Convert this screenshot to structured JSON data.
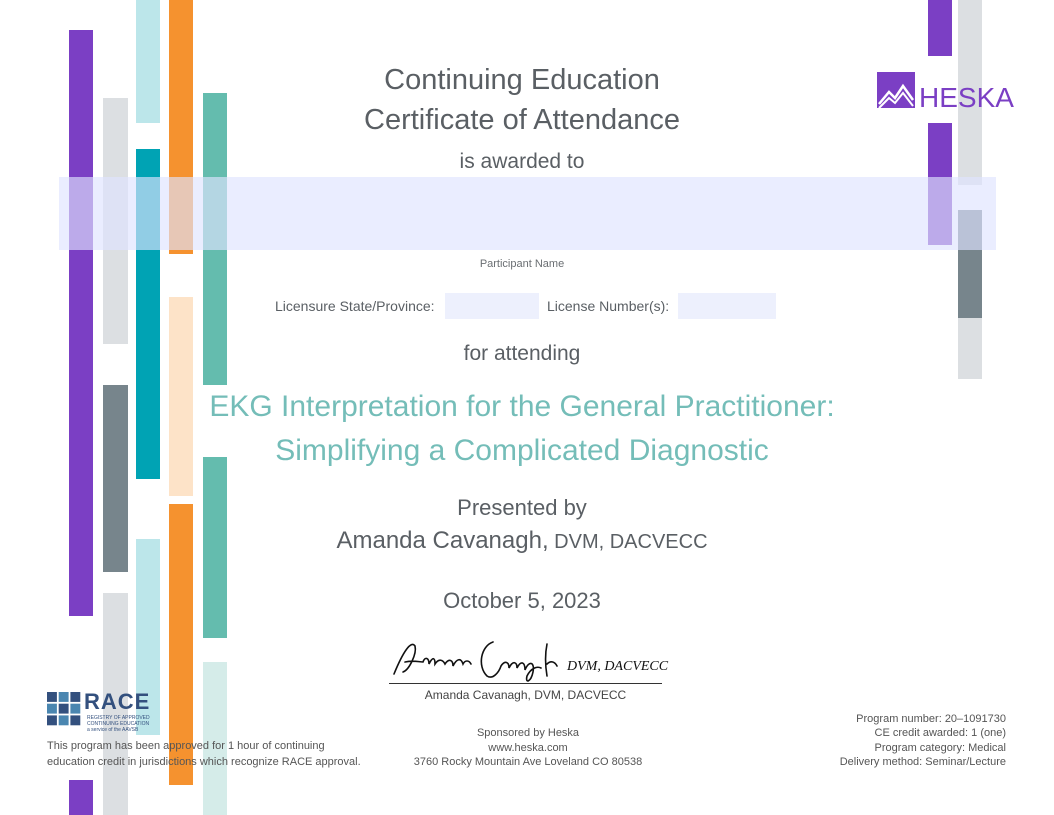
{
  "header": {
    "title_line1": "Continuing Education",
    "title_line2": "Certificate of Attendance",
    "awarded_to": "is awarded to"
  },
  "participant": {
    "name_label": "Participant Name",
    "name_value": ""
  },
  "licensure": {
    "state_label": "Licensure State/Province:",
    "state_value": "",
    "number_label": "License Number(s):",
    "number_value": ""
  },
  "course": {
    "for_attending": "for attending",
    "title_line1": "EKG Interpretation for the General Practitioner:",
    "title_line2": "Simplifying a Complicated Diagnostic"
  },
  "presenter": {
    "presented_by": "Presented by",
    "name": "Amanda Cavanagh,",
    "credentials": " DVM, DACVECC"
  },
  "event": {
    "date": "October 5, 2023"
  },
  "signature": {
    "caption": "Amanda Cavanagh, DVM, DACVECC"
  },
  "race": {
    "logo_text": "RACE",
    "logo_subtext_1": "REGISTRY OF APPROVED",
    "logo_subtext_2": "CONTINUING EDUCATION",
    "logo_subtext_3": "a service of the AAVSB",
    "approval_line1": "This program has been approved for 1 hour of continuing",
    "approval_line2": "education credit in jurisdictions which recognize RACE approval."
  },
  "sponsor": {
    "line1": "Sponsored by Heska",
    "line2": "www.heska.com",
    "line3": "3760 Rocky Mountain Ave  Loveland CO 80538"
  },
  "program": {
    "number": "Program number: 20–1091730",
    "credit": "CE credit awarded: 1 (one)",
    "category": "Program category: Medical",
    "delivery": "Delivery method: Seminar/Lecture"
  },
  "brand": {
    "logo_text": "HESKA",
    "purple": "#7b3fc4",
    "teal": "#64bcae",
    "orange": "#f5922f",
    "light_blue": "#bce6ea",
    "dark_teal": "#00a3b4",
    "gray": "#77858c",
    "light_gray": "#dcdfe2",
    "peach": "#fde3c8",
    "course_title_color": "#74bdb8"
  },
  "icons": {
    "race_logo": "race-logo-icon",
    "heska_logo": "heska-mountain-icon"
  }
}
